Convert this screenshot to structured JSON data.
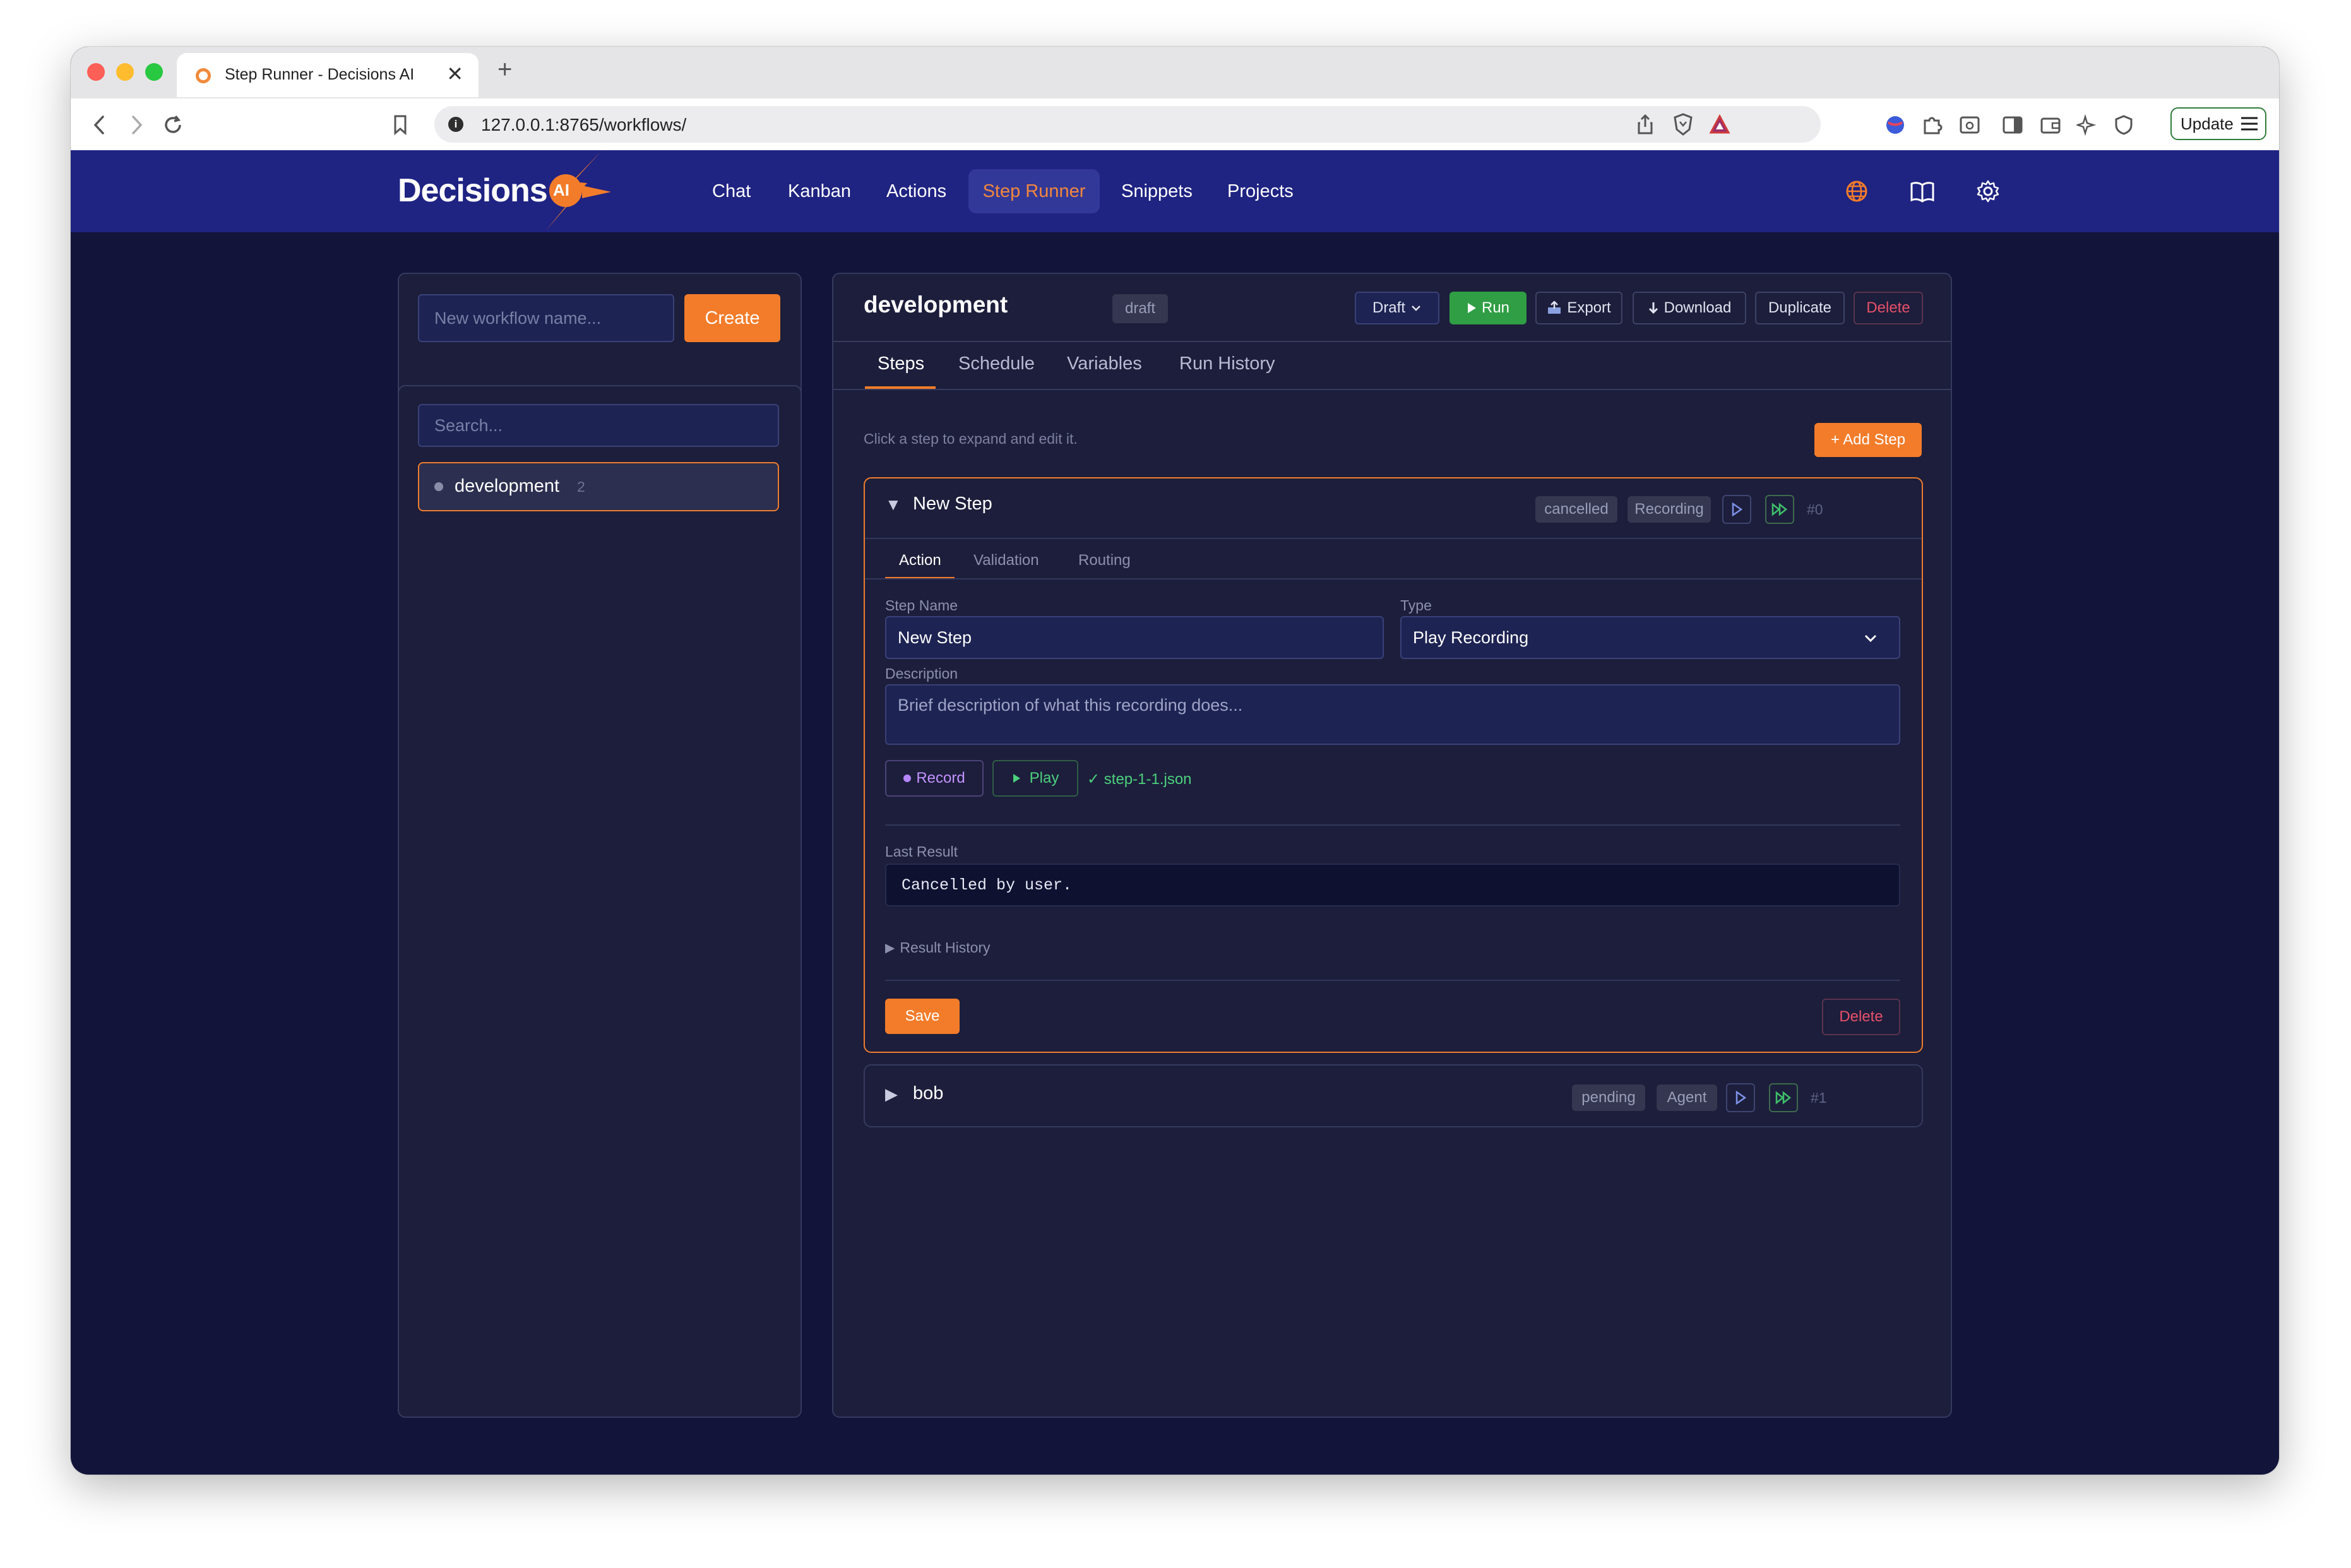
{
  "browser": {
    "tab_title": "Step Runner - Decisions AI",
    "tab_close": "✕",
    "new_tab": "+",
    "url": "127.0.0.1:8765/workflows/",
    "update_label": "Update"
  },
  "app": {
    "logo_text": "Decisions",
    "logo_badge": "AI",
    "nav": [
      "Chat",
      "Kanban",
      "Actions",
      "Step Runner",
      "Snippets",
      "Projects"
    ],
    "active_nav": "Step Runner",
    "accent_color": "#f37c2a",
    "header_color": "#1f2382"
  },
  "sidebar": {
    "new_workflow_placeholder": "New workflow name...",
    "create_label": "Create",
    "search_placeholder": "Search...",
    "workflows": [
      {
        "name": "development",
        "count": "2"
      }
    ]
  },
  "workflow": {
    "name": "development",
    "status_badge": "draft",
    "toolbar": {
      "draft": "Draft",
      "run": "Run",
      "export": "Export",
      "download": "Download",
      "duplicate": "Duplicate",
      "delete": "Delete"
    },
    "tabs": [
      "Steps",
      "Schedule",
      "Variables",
      "Run History"
    ],
    "hint": "Click a step to expand and edit it.",
    "add_step": "+ Add Step",
    "steps": [
      {
        "name": "New Step",
        "status": "cancelled",
        "kind": "Recording",
        "index": "#0",
        "expanded": true,
        "inner_tabs": [
          "Action",
          "Validation",
          "Routing"
        ],
        "step_name_label": "Step Name",
        "step_name_value": "New Step",
        "type_label": "Type",
        "type_value": "Play Recording",
        "description_label": "Description",
        "description_placeholder": "Brief description of what this recording does...",
        "record_label": "Record",
        "play_label": "Play",
        "recording_file": "✓ step-1-1.json",
        "last_result_label": "Last Result",
        "last_result_value": "Cancelled by user.",
        "result_history_label": "Result History",
        "save_label": "Save",
        "delete_label": "Delete"
      },
      {
        "name": "bob",
        "status": "pending",
        "kind": "Agent",
        "index": "#1",
        "expanded": false
      }
    ]
  }
}
